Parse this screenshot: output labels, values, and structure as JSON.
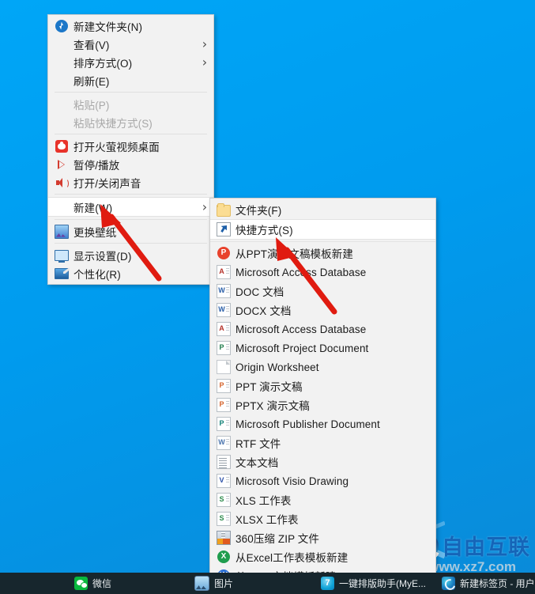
{
  "desktop": {
    "background_color": "#00a2f3",
    "watermark": {
      "logo_text": "自由互联",
      "url_text": "www.xz7.com"
    }
  },
  "context_menu": {
    "name": "desktop-context-menu",
    "items": [
      {
        "label": "新建文件夹(N)",
        "icon": "new-folder-icon",
        "type": "item",
        "disabled": false,
        "submenu": false
      },
      {
        "label": "查看(V)",
        "icon": "",
        "type": "item",
        "disabled": false,
        "submenu": true
      },
      {
        "label": "排序方式(O)",
        "icon": "",
        "type": "item",
        "disabled": false,
        "submenu": true
      },
      {
        "label": "刷新(E)",
        "icon": "",
        "type": "item",
        "disabled": false,
        "submenu": false
      },
      {
        "type": "separator"
      },
      {
        "label": "粘贴(P)",
        "icon": "",
        "type": "item",
        "disabled": true,
        "submenu": false
      },
      {
        "label": "粘贴快捷方式(S)",
        "icon": "",
        "type": "item",
        "disabled": true,
        "submenu": false
      },
      {
        "type": "separator"
      },
      {
        "label": "打开火萤视频桌面",
        "icon": "firefly-video-icon",
        "type": "item",
        "disabled": false,
        "submenu": false
      },
      {
        "label": "暂停/播放",
        "icon": "play-pause-icon",
        "type": "item",
        "disabled": false,
        "submenu": false
      },
      {
        "label": "打开/关闭声音",
        "icon": "sound-icon",
        "type": "item",
        "disabled": false,
        "submenu": false
      },
      {
        "type": "separator"
      },
      {
        "label": "新建(W)",
        "icon": "",
        "type": "item",
        "disabled": false,
        "submenu": true,
        "highlighted": true
      },
      {
        "type": "separator"
      },
      {
        "label": "更换壁纸",
        "icon": "wallpaper-icon",
        "type": "item",
        "disabled": false,
        "submenu": false
      },
      {
        "type": "separator"
      },
      {
        "label": "显示设置(D)",
        "icon": "monitor-icon",
        "type": "item",
        "disabled": false,
        "submenu": false
      },
      {
        "label": "个性化(R)",
        "icon": "personalize-icon",
        "type": "item",
        "disabled": false,
        "submenu": false
      }
    ]
  },
  "new_submenu": {
    "name": "new-submenu",
    "items": [
      {
        "label": "文件夹(F)",
        "icon": "folder-icon",
        "type": "item"
      },
      {
        "label": "快捷方式(S)",
        "icon": "shortcut-icon",
        "type": "item",
        "highlighted": true
      },
      {
        "type": "separator"
      },
      {
        "label": "从PPT演示文稿模板新建",
        "icon": "wps-powerpoint-icon",
        "type": "item"
      },
      {
        "label": "Microsoft Access Database",
        "icon": "access-mdb-icon",
        "type": "item"
      },
      {
        "label": "DOC 文档",
        "icon": "word-doc-icon",
        "type": "item"
      },
      {
        "label": "DOCX 文档",
        "icon": "word-docx-icon",
        "type": "item"
      },
      {
        "label": "Microsoft Access Database",
        "icon": "access-accdb-icon",
        "type": "item"
      },
      {
        "label": "Microsoft Project Document",
        "icon": "project-icon",
        "type": "item"
      },
      {
        "label": "Origin Worksheet",
        "icon": "origin-worksheet-icon",
        "type": "item"
      },
      {
        "label": "PPT 演示文稿",
        "icon": "powerpoint-ppt-icon",
        "type": "item"
      },
      {
        "label": "PPTX 演示文稿",
        "icon": "powerpoint-pptx-icon",
        "type": "item"
      },
      {
        "label": "Microsoft Publisher Document",
        "icon": "publisher-icon",
        "type": "item"
      },
      {
        "label": "RTF 文件",
        "icon": "rtf-icon",
        "type": "item"
      },
      {
        "label": "文本文档",
        "icon": "text-document-icon",
        "type": "item"
      },
      {
        "label": "Microsoft Visio Drawing",
        "icon": "visio-icon",
        "type": "item"
      },
      {
        "label": "XLS 工作表",
        "icon": "excel-xls-icon",
        "type": "item"
      },
      {
        "label": "XLSX 工作表",
        "icon": "excel-xlsx-icon",
        "type": "item"
      },
      {
        "label": "360压缩 ZIP 文件",
        "icon": "zip-360-icon",
        "type": "item"
      },
      {
        "label": "从Excel工作表模板新建",
        "icon": "wps-excel-icon",
        "type": "item"
      },
      {
        "label": "从Word文档模板新建",
        "icon": "wps-word-icon",
        "type": "item"
      }
    ]
  },
  "annotations": {
    "arrows": [
      {
        "name": "arrow-to-new-item",
        "target": "新建(W)",
        "color": "#e01b10"
      },
      {
        "name": "arrow-to-shortcut-item",
        "target": "快捷方式(S)",
        "color": "#e01b10"
      }
    ]
  },
  "taskbar": {
    "items": [
      {
        "label": "微信",
        "icon": "wechat-icon"
      },
      {
        "label": "图片",
        "icon": "photos-icon"
      },
      {
        "label": "一键排版助手(MyE...",
        "icon": "paiban-assistant-icon"
      },
      {
        "label": "新建标签页 - 用户",
        "icon": "edge-icon"
      }
    ]
  }
}
